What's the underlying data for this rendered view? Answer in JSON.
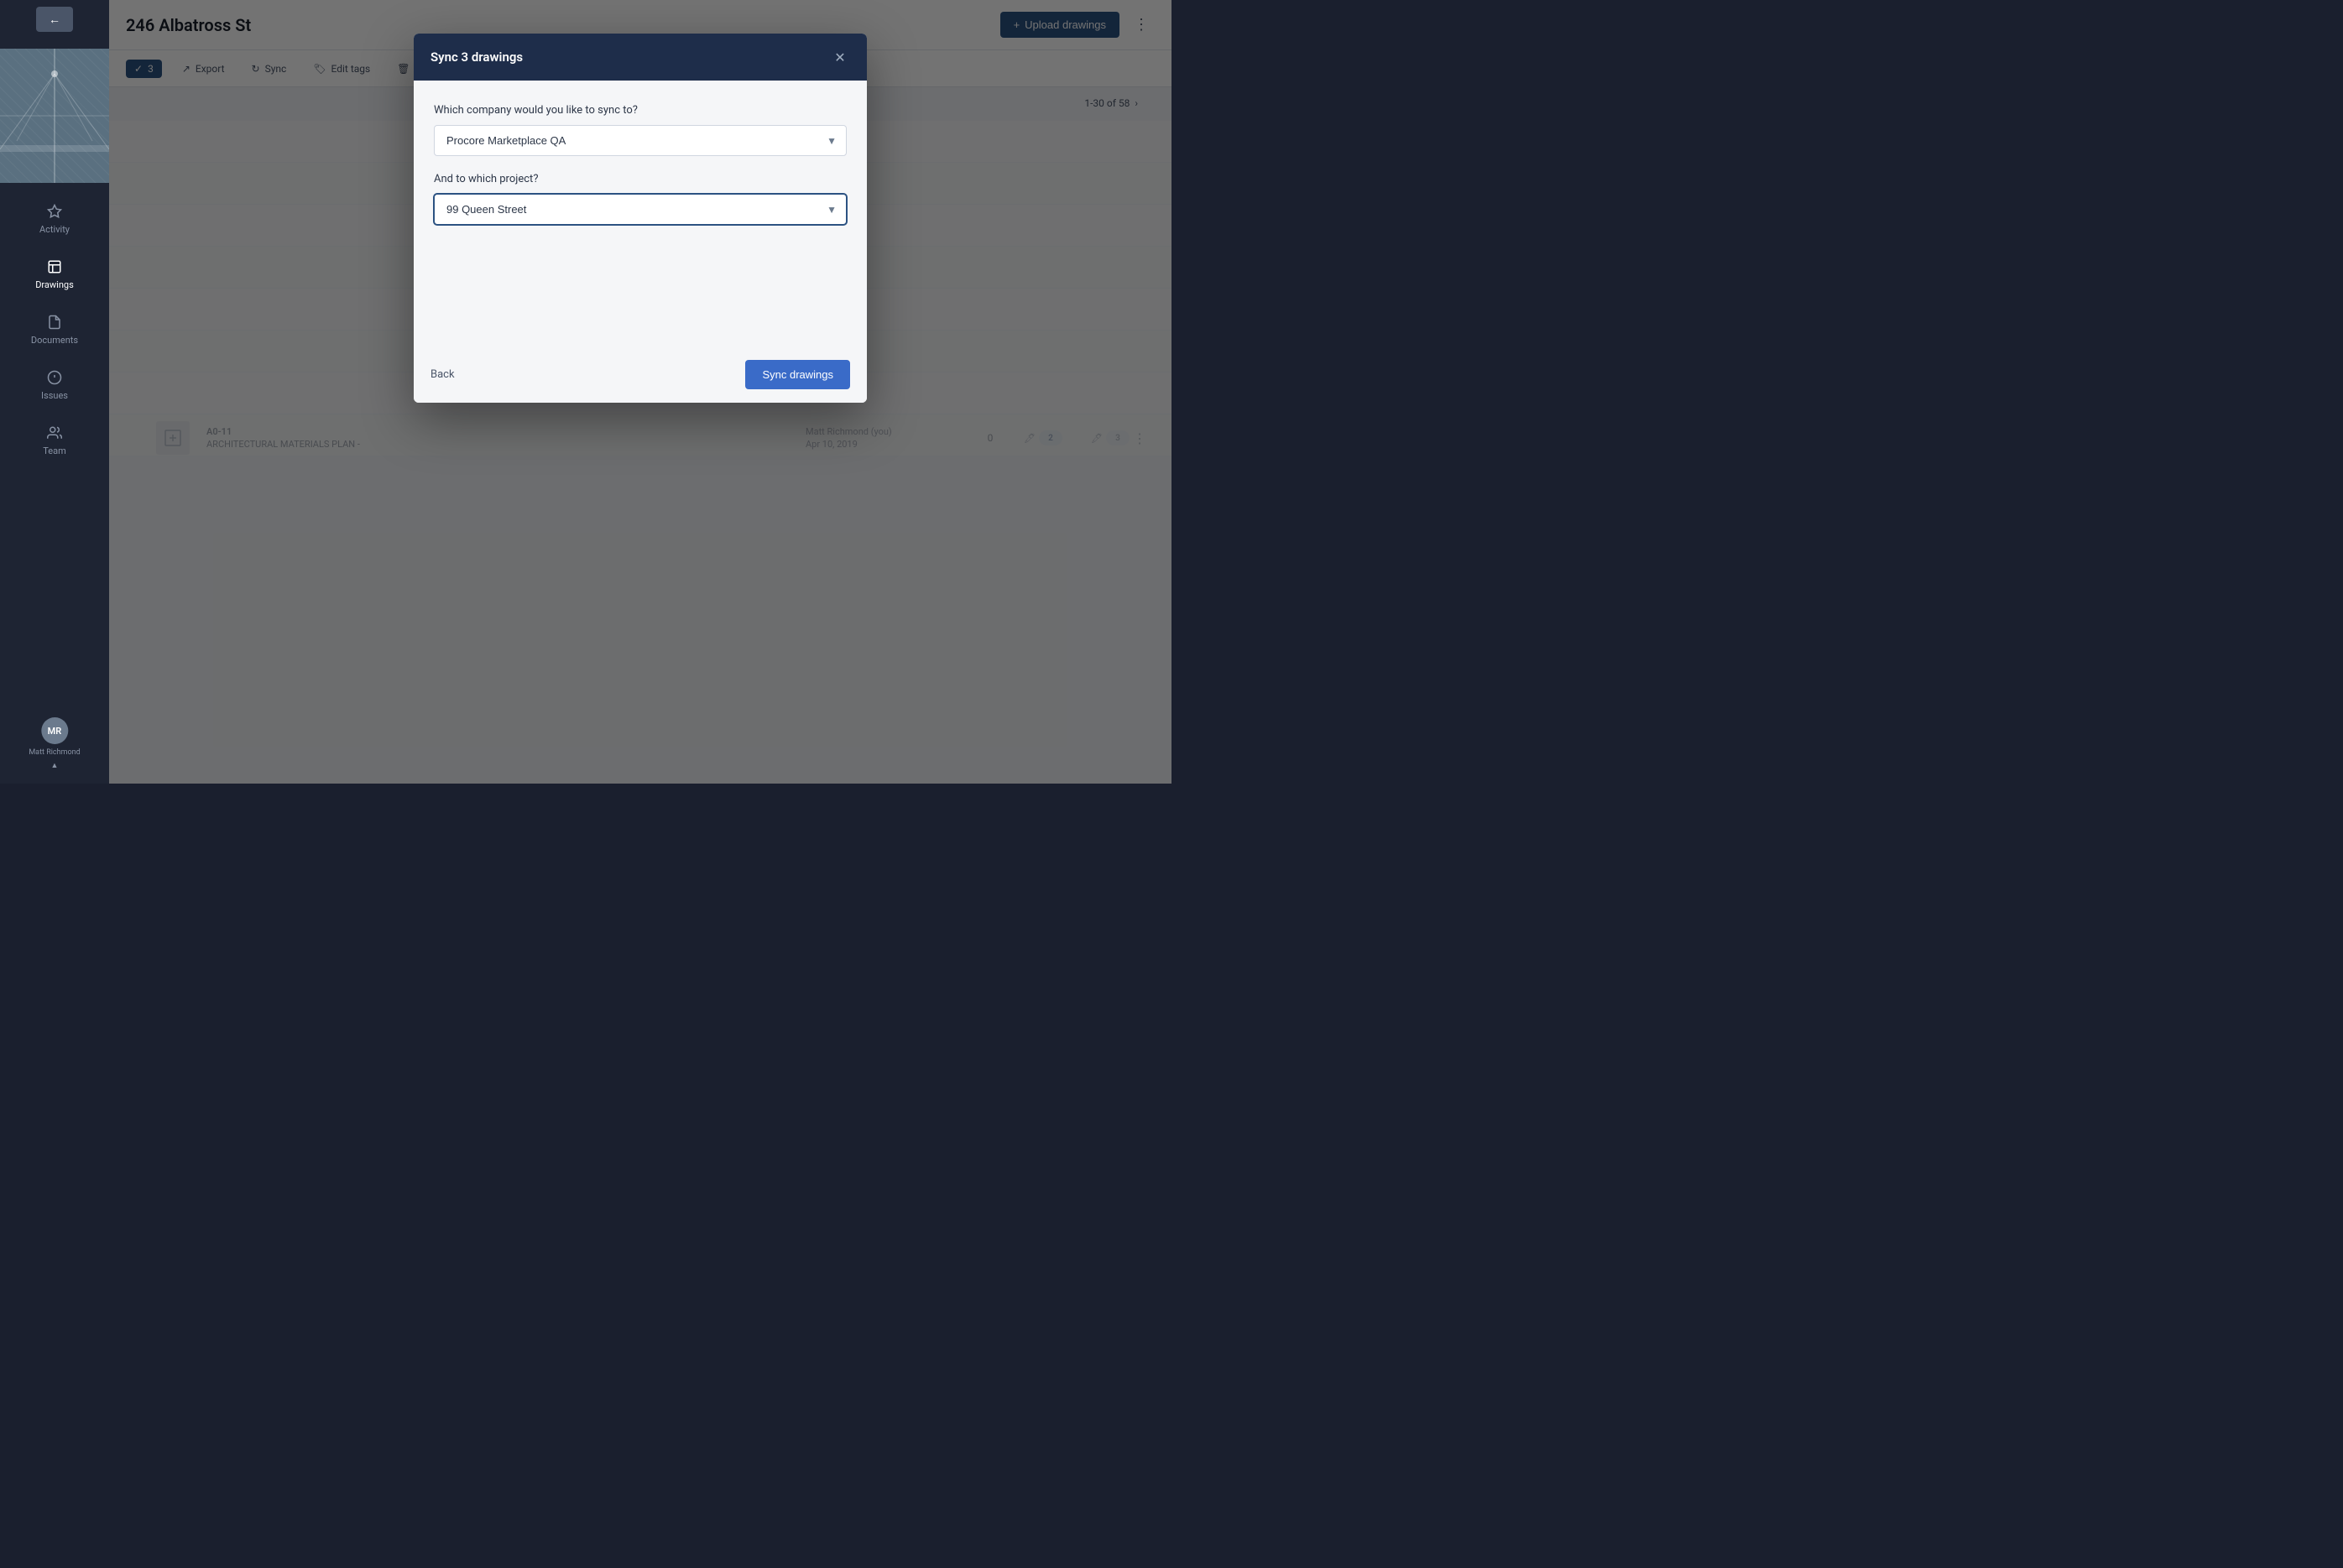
{
  "app": {
    "project_title": "246 Albatross St"
  },
  "sidebar": {
    "back_label": "←",
    "items": [
      {
        "id": "activity",
        "label": "Activity",
        "icon": "⬡"
      },
      {
        "id": "drawings",
        "label": "Drawings",
        "icon": "⊞"
      },
      {
        "id": "documents",
        "label": "Documents",
        "icon": "☐"
      },
      {
        "id": "issues",
        "label": "Issues",
        "icon": "⚐"
      },
      {
        "id": "team",
        "label": "Team",
        "icon": "👥"
      }
    ],
    "user_name": "Matt Richmond"
  },
  "toolbar": {
    "selected_count": "3",
    "export_label": "Export",
    "sync_label": "Sync",
    "edit_tags_label": "Edit tags",
    "delete_label": "Delete"
  },
  "pagination": {
    "text": "1-30 of 58"
  },
  "modal": {
    "title": "Sync 3 drawings",
    "close_label": "✕",
    "company_label": "Which company would you like to sync to?",
    "company_value": "Procore Marketplace QA",
    "project_label": "And to which project?",
    "project_value": "99 Queen Street",
    "back_label": "Back",
    "sync_label": "Sync drawings",
    "company_options": [
      "Procore Marketplace QA"
    ],
    "project_options": [
      "99 Queen Street"
    ]
  },
  "table": {
    "rows": [
      {
        "id": "A0-11",
        "name": "ARCHITECTURAL MATERIALS PLAN -",
        "user": "Matt Richmond (you)",
        "date": "Apr 10, 2019",
        "count": "0",
        "badge1": "2",
        "badge2": "3"
      }
    ]
  }
}
